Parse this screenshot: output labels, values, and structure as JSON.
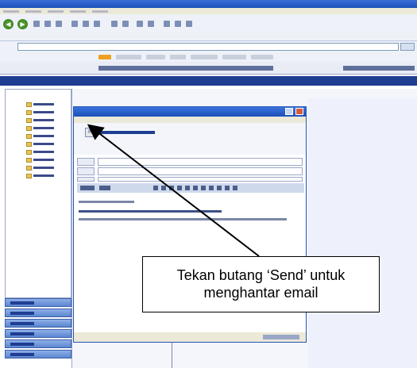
{
  "browser": {
    "nav_back_icon": "back-arrow-icon",
    "nav_forward_icon": "forward-arrow-icon"
  },
  "compose": {
    "send_label": "Send"
  },
  "annotation": {
    "line1": "Tekan butang ‘Send’ untuk",
    "line2": "menghantar email"
  },
  "colors": {
    "titlebar": "#1d4fb8",
    "app_header": "#1f3e92",
    "nav_green": "#2f7a1a"
  }
}
